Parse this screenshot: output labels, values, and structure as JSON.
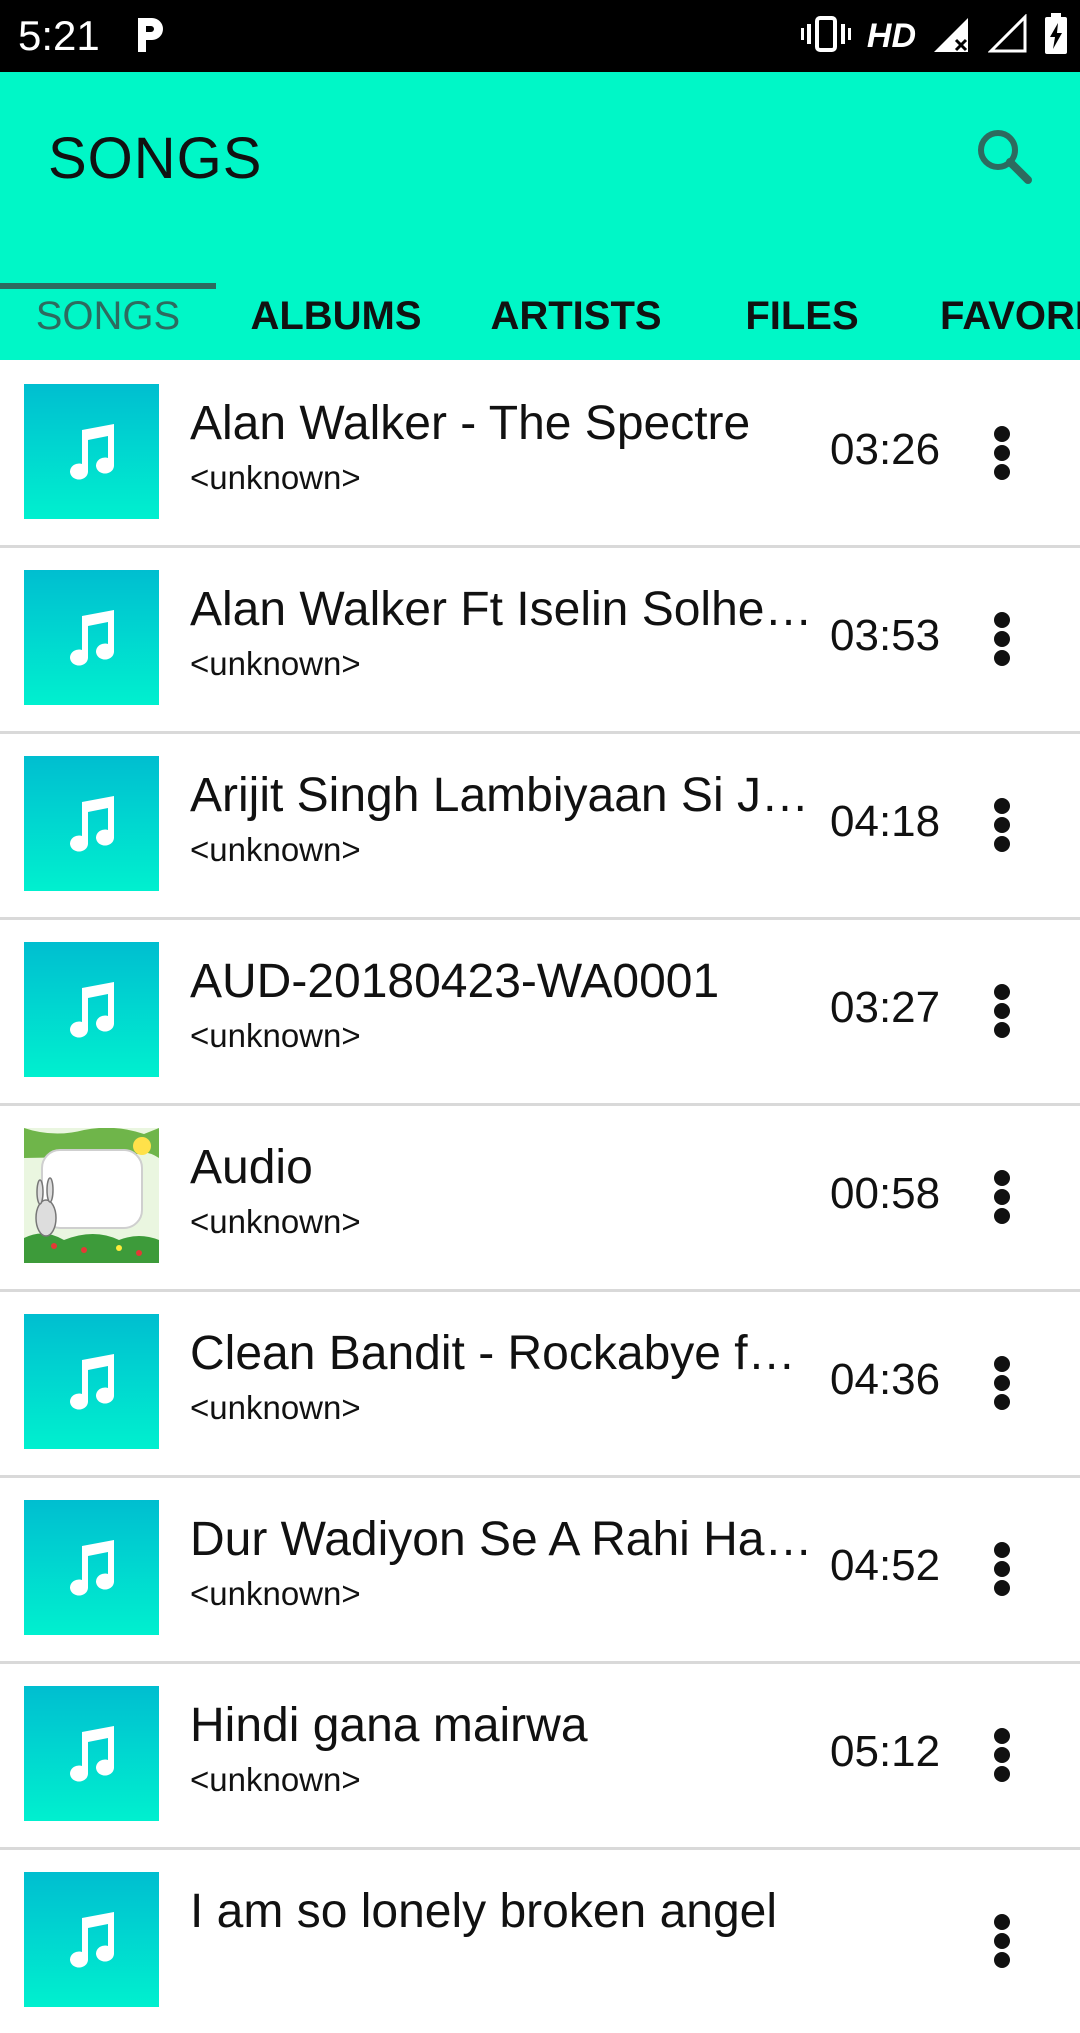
{
  "status_bar": {
    "time": "5:21",
    "network": "HD"
  },
  "app_bar": {
    "title": "SONGS"
  },
  "tabs": [
    {
      "label": "SONGS",
      "selected": true
    },
    {
      "label": "ALBUMS",
      "selected": false
    },
    {
      "label": "ARTISTS",
      "selected": false
    },
    {
      "label": "FILES",
      "selected": false
    },
    {
      "label": "FAVORI",
      "selected": false
    }
  ],
  "songs": [
    {
      "title": "Alan Walker - The Spectre",
      "artist": "<unknown>",
      "duration": "03:26",
      "art": "music-note"
    },
    {
      "title": "Alan Walker Ft  Iselin Solhei…",
      "artist": "<unknown>",
      "duration": "03:53",
      "art": "music-note"
    },
    {
      "title": "Arijit Singh  Lambiyaan Si J…",
      "artist": "<unknown>",
      "duration": "04:18",
      "art": "music-note"
    },
    {
      "title": "AUD-20180423-WA0001",
      "artist": "<unknown>",
      "duration": "03:27",
      "art": "music-note"
    },
    {
      "title": "Audio",
      "artist": "<unknown>",
      "duration": "00:58",
      "art": "cartoon-frame"
    },
    {
      "title": "Clean Bandit - Rockabye feat",
      "artist": "<unknown>",
      "duration": "04:36",
      "art": "music-note"
    },
    {
      "title": "Dur Wadiyon Se A Rahi Hai…",
      "artist": "<unknown>",
      "duration": "04:52",
      "art": "music-note"
    },
    {
      "title": "Hindi gana mairwa",
      "artist": "<unknown>",
      "duration": "05:12",
      "art": "music-note"
    },
    {
      "title": "I am so lonely broken angel",
      "artist": "",
      "duration": "",
      "art": "music-note"
    }
  ],
  "colors": {
    "accent": "#00f7c7",
    "tab_selected": "#2d6b5f",
    "art_top": "#00bed0",
    "art_bottom": "#00f0cf"
  }
}
